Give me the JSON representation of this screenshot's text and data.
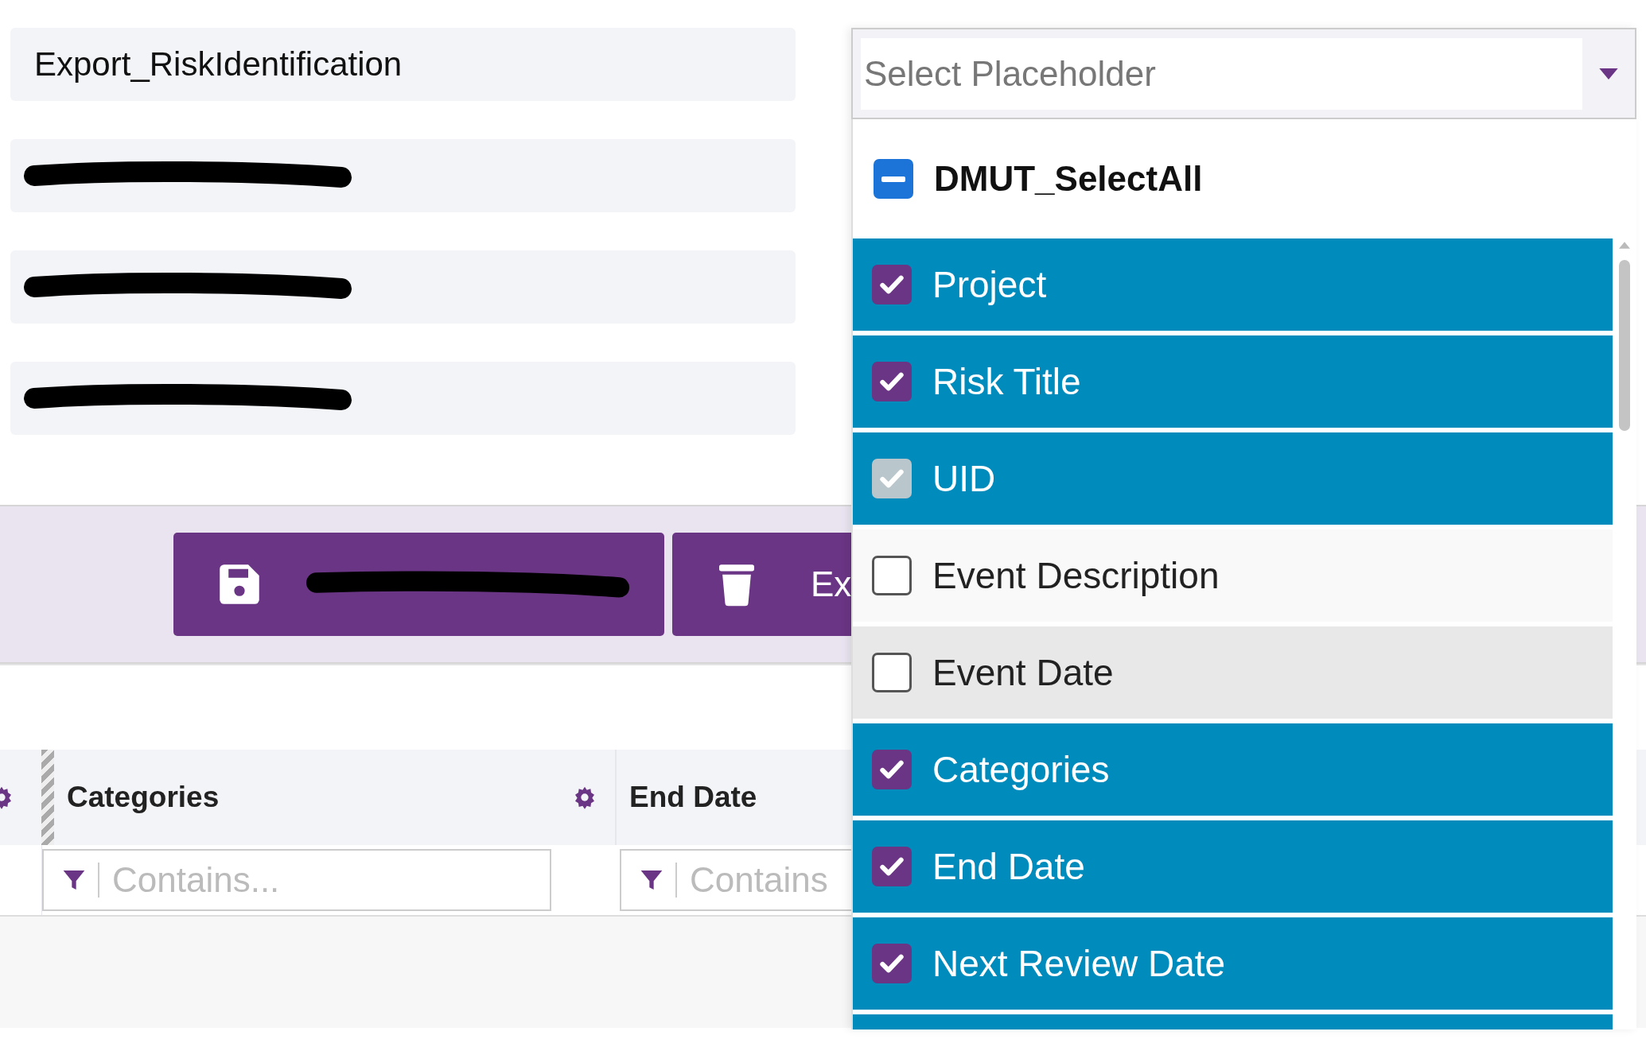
{
  "fields": [
    {
      "text": "Export_RiskIdentification",
      "redacted": false
    },
    {
      "redacted": true
    },
    {
      "redacted": true
    },
    {
      "redacted": true
    }
  ],
  "actions": [
    {
      "kind": "save",
      "redacted": true
    },
    {
      "kind": "delete",
      "redacted": false,
      "label": "Ex"
    }
  ],
  "table": {
    "columns": [
      {
        "label": "Categories",
        "filter_placeholder": "Contains..."
      },
      {
        "label": "End Date",
        "filter_placeholder": "Contains"
      }
    ]
  },
  "dropdown": {
    "placeholder": "Select Placeholder",
    "select_all": {
      "label": "DMUT_SelectAll",
      "indeterminate": true
    },
    "items": [
      {
        "label": "Project",
        "checked": true,
        "disabled": false
      },
      {
        "label": "Risk Title",
        "checked": true,
        "disabled": false
      },
      {
        "label": "UID",
        "checked": true,
        "disabled": true
      },
      {
        "label": "Event Description",
        "checked": false,
        "disabled": false,
        "hovered": false
      },
      {
        "label": "Event Date",
        "checked": false,
        "disabled": false,
        "hovered": true
      },
      {
        "label": "Categories",
        "checked": true,
        "disabled": false
      },
      {
        "label": "End Date",
        "checked": true,
        "disabled": false
      },
      {
        "label": "Next Review Date",
        "checked": true,
        "disabled": false
      },
      {
        "checked": true
      }
    ]
  }
}
